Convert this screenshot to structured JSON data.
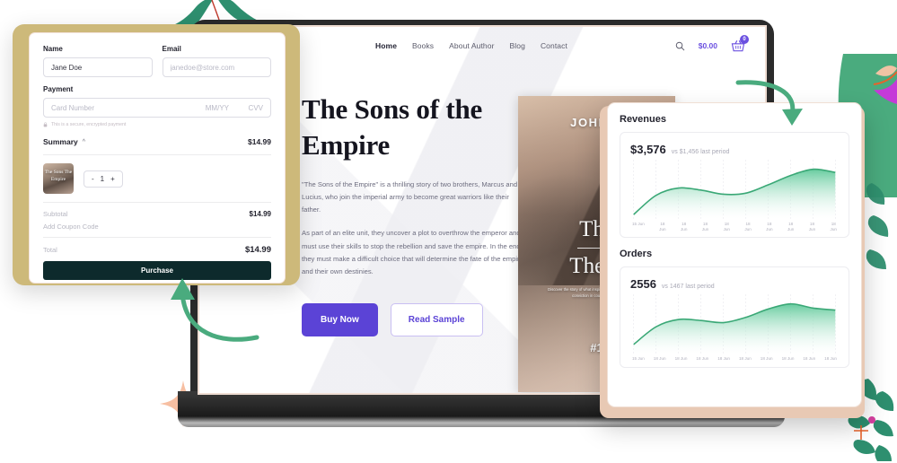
{
  "theme": {
    "accent_purple": "#5b43d6",
    "accent_green": "#4aab7e",
    "dark_button": "#0d2a2c",
    "gold_frame": "#cdb97a",
    "peach_frame": "#e8c9b4",
    "star_color": "#f7bfa2"
  },
  "site": {
    "nav": {
      "links": [
        {
          "label": "Home",
          "active": true
        },
        {
          "label": "Books",
          "active": false
        },
        {
          "label": "About Author",
          "active": false
        },
        {
          "label": "Blog",
          "active": false
        },
        {
          "label": "Contact",
          "active": false
        }
      ],
      "search_icon": "search-icon",
      "cart_price": "$0.00",
      "cart_icon": "shopping-basket-icon",
      "cart_count": "0"
    },
    "hero": {
      "title": "The Sons of the Empire",
      "paragraph_1": "\"The Sons of the Empire\" is a thrilling story of two brothers, Marcus and Lucius, who join the imperial army to become great warriors like their father.",
      "paragraph_2": "As part of an elite unit, they uncover a plot to overthrow the emperor and must use their skills to stop the rebellion and save the empire. In the end, they must make a difficult choice that will determine the fate of the empire and their own destinies.",
      "buy_label": "Buy Now",
      "sample_label": "Read Sample"
    },
    "book_cover": {
      "author": "JOHN R",
      "title_line_1": "The",
      "title_line_2": "The E",
      "subtitle": "Discover the story of what inspired generations and placed conviction in countless hearts",
      "rank": "#1"
    }
  },
  "checkout": {
    "name_label": "Name",
    "name_value": "Jane Doe",
    "email_label": "Email",
    "email_placeholder": "janedoe@store.com",
    "payment_label": "Payment",
    "card_number_placeholder": "Card Number",
    "card_expiry_placeholder": "MM/YY",
    "card_cvv_placeholder": "CVV",
    "secure_note": "This is a secure, encrypted payment",
    "lock_icon": "lock-icon",
    "summary_label": "Summary",
    "summary_chevron": "chevron-up-icon",
    "summary_amount": "$14.99",
    "item_thumb_title": "The Sons\nThe Empire",
    "qty_minus": "-",
    "qty_value": "1",
    "qty_plus": "+",
    "subtotal_label": "Subtotal",
    "subtotal_value": "$14.99",
    "coupon_label": "Add Coupon Code",
    "total_label": "Total",
    "total_value": "$14.99",
    "purchase_label": "Purchase"
  },
  "dashboard": {
    "sections": [
      {
        "title": "Revenues",
        "value": "$3,576",
        "comparison": "vs $1,456 last period"
      },
      {
        "title": "Orders",
        "value": "2556",
        "comparison": "vs 1467 last period"
      }
    ]
  },
  "chart_data": [
    {
      "type": "area",
      "title": "Revenues",
      "subtitle": "$3,576 vs $1,456 last period",
      "xlabel": "",
      "ylabel": "",
      "grid": true,
      "legend": "none",
      "x": [
        "15 Jun",
        "18 Jun",
        "18 Jun",
        "18 Jun",
        "18 Jun",
        "18 Jun",
        "18 Jun",
        "18 Jun",
        "18 Jun",
        "18 Jun"
      ],
      "categories": [
        "15 Jun",
        "18 Jun",
        "18 Jun",
        "18 Jun",
        "18 Jun",
        "18 Jun",
        "18 Jun",
        "18 Jun",
        "18 Jun",
        "18 Jun"
      ],
      "values": [
        5,
        42,
        56,
        52,
        44,
        46,
        62,
        80,
        92,
        86
      ],
      "ylim": [
        0,
        100
      ],
      "line_color": "#3aa876",
      "fill_gradient": [
        "#5fc99a",
        "#ffffff"
      ]
    },
    {
      "type": "area",
      "title": "Orders",
      "subtitle": "2556 vs 1467 last period",
      "xlabel": "",
      "ylabel": "",
      "grid": true,
      "legend": "none",
      "x": [
        "15 Jun",
        "18 Jun",
        "18 Jun",
        "18 Jun",
        "18 Jun",
        "18 Jun",
        "18 Jun",
        "18 Jun",
        "18 Jun",
        "18 Jun"
      ],
      "categories": [
        "15 Jun",
        "18 Jun",
        "18 Jun",
        "18 Jun",
        "18 Jun",
        "18 Jun",
        "18 Jun",
        "18 Jun",
        "18 Jun",
        "18 Jun"
      ],
      "values": [
        14,
        48,
        62,
        60,
        56,
        66,
        82,
        92,
        84,
        80
      ],
      "ylim": [
        0,
        100
      ],
      "line_color": "#3aa876",
      "fill_gradient": [
        "#5fc99a",
        "#ffffff"
      ]
    }
  ],
  "decorations": {
    "arrow_to_dashboard": "curved-arrow-down-icon",
    "arrow_to_purchase": "curved-arrow-up-icon",
    "star": "four-point-star-icon",
    "leaf_top_left": "leaf-icon",
    "leaf_right": "leaf-icon"
  }
}
